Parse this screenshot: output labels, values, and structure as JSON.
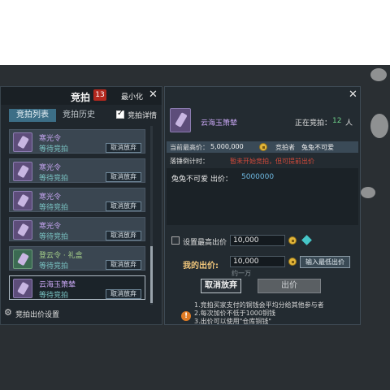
{
  "colors": {
    "panel_bg": "#20272d",
    "accent_tab": "#3c6e86",
    "badge": "#b3281e",
    "countdown_red": "#d24a3a",
    "purple_item": "#c7a6f2",
    "green_item": "#a6d08a",
    "bid_amount": "#6eb8e0"
  },
  "left_panel": {
    "title": "竞拍",
    "badge": "13",
    "minimize_label": "最小化",
    "close_icon": "close-icon",
    "tabs": [
      {
        "label": "竞拍列表",
        "active": true
      },
      {
        "label": "竞拍历史",
        "active": false
      }
    ],
    "detail_checkbox_label": "竞拍详情",
    "detail_checked": true,
    "items": [
      {
        "name": "寒光令",
        "status": "等待竞拍",
        "button": "取消放弃",
        "icon": "purple-token-icon"
      },
      {
        "name": "寒光令",
        "status": "等待竞拍",
        "button": "取消放弃",
        "icon": "purple-token-icon"
      },
      {
        "name": "寒光令",
        "status": "等待竞拍",
        "button": "取消放弃",
        "icon": "purple-token-icon"
      },
      {
        "name": "寒光令",
        "status": "等待竞拍",
        "button": "取消放弃",
        "icon": "purple-token-icon"
      },
      {
        "name": "登云令 · 礼盒",
        "status": "等待竞拍",
        "button": "取消放弃",
        "icon": "green-box-icon"
      },
      {
        "name": "云海玉箫辇",
        "status": "等待竞拍",
        "button": "取消放弃",
        "icon": "purple-token-icon"
      }
    ],
    "settings_label": "竞拍出价设置"
  },
  "right_panel": {
    "item_name": "云海玉箫辇",
    "bidders_label": "正在竞拍：",
    "bidders_count": "12",
    "bidders_unit": "人",
    "highest_bid_label": "当前最高价：",
    "highest_bid_value": "5,000,000",
    "bidder_label": "竞拍者",
    "bidder_name": "兔兔不可爱",
    "countdown_label": "落锤倒计时：",
    "countdown_text": "暂未开始竞拍，但可提前出价",
    "bid_log": [
      {
        "user": "兔兔不可爱  出价：",
        "amount": "5000000"
      }
    ],
    "max_bid_label": "设置最高出价",
    "max_bid_value": "10,000",
    "my_bid_label": "我的出价:",
    "my_bid_value": "10,000",
    "approx_label": "约一万",
    "min_bid_button": "输入最低出价",
    "abandon_button": "取消放弃",
    "bid_button": "出价",
    "rules": [
      "1.竞拍买家支付的铜钱会平均分给其他参与者",
      "2.每次加价不低于1000铜钱",
      "3.出价可以使用\"仓库铜钱\""
    ]
  }
}
